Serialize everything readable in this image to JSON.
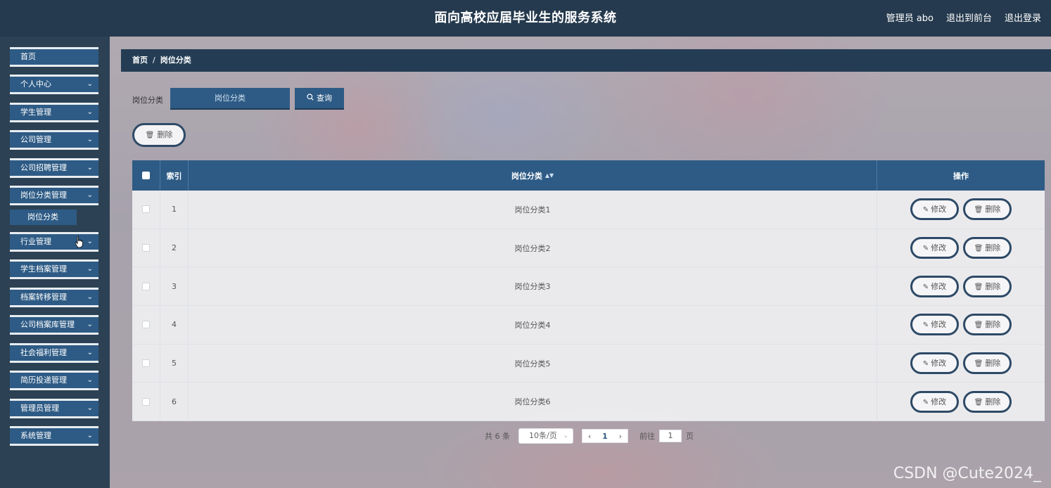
{
  "header": {
    "title": "面向高校应届毕业生的服务系统",
    "user": "管理员 abo",
    "to_front": "退出到前台",
    "logout": "退出登录"
  },
  "sidebar": {
    "items": [
      {
        "label": "首页",
        "has_chevron": false
      },
      {
        "label": "个人中心",
        "has_chevron": true
      },
      {
        "label": "学生管理",
        "has_chevron": true
      },
      {
        "label": "公司管理",
        "has_chevron": true
      },
      {
        "label": "公司招聘管理",
        "has_chevron": true
      },
      {
        "label": "岗位分类管理",
        "has_chevron": true,
        "expanded": true
      },
      {
        "label": "行业管理",
        "has_chevron": true
      },
      {
        "label": "学生档案管理",
        "has_chevron": true
      },
      {
        "label": "档案转移管理",
        "has_chevron": true
      },
      {
        "label": "公司档案库管理",
        "has_chevron": true
      },
      {
        "label": "社会福利管理",
        "has_chevron": true
      },
      {
        "label": "简历投递管理",
        "has_chevron": true
      },
      {
        "label": "管理员管理",
        "has_chevron": true
      },
      {
        "label": "系统管理",
        "has_chevron": true
      }
    ],
    "submenu": {
      "label": "岗位分类"
    }
  },
  "breadcrumb": {
    "home": "首页",
    "sep": "/",
    "current": "岗位分类"
  },
  "search": {
    "label": "岗位分类",
    "placeholder": "岗位分类",
    "query_label": "查询"
  },
  "toolbar": {
    "delete_label": "删除"
  },
  "table": {
    "headers": {
      "index": "索引",
      "name": "岗位分类",
      "ops": "操作"
    },
    "rows": [
      {
        "index": "1",
        "name": "岗位分类1"
      },
      {
        "index": "2",
        "name": "岗位分类2"
      },
      {
        "index": "3",
        "name": "岗位分类3"
      },
      {
        "index": "4",
        "name": "岗位分类4"
      },
      {
        "index": "5",
        "name": "岗位分类5"
      },
      {
        "index": "6",
        "name": "岗位分类6"
      }
    ],
    "edit_label": "修改",
    "delete_label": "删除"
  },
  "pagination": {
    "total": "共 6 条",
    "page_size": "10条/页",
    "current_page": "1",
    "goto_label": "前往",
    "goto_value": "1",
    "page_suffix": "页"
  },
  "watermark": "CSDN @Cute2024_",
  "colors": {
    "header_bg": "#253a4e",
    "sidebar_bg": "#2c4154",
    "accent": "#2e5b85",
    "button_border": "#2e4a66"
  }
}
